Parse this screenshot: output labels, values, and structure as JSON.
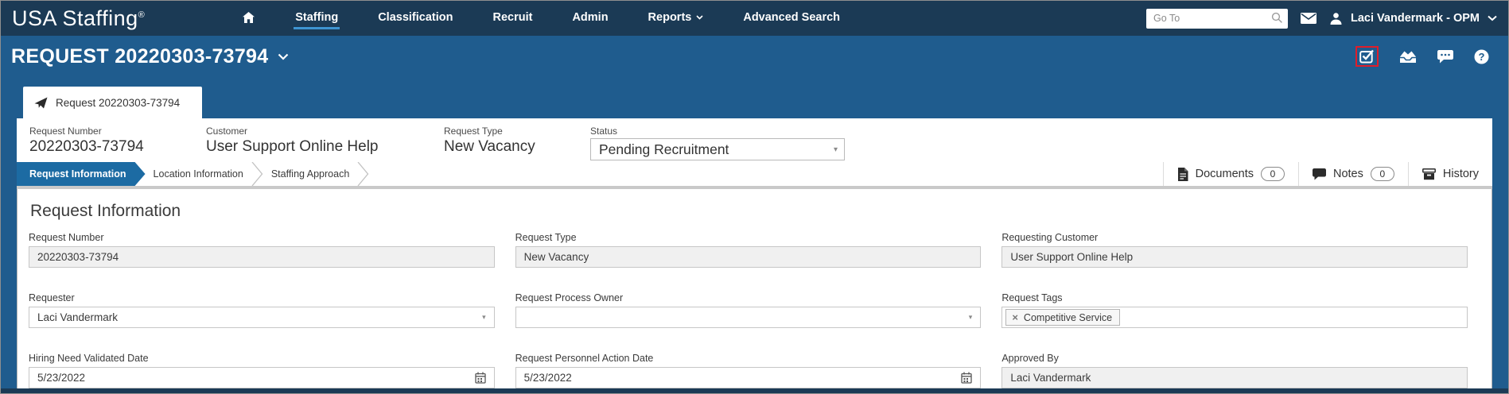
{
  "navbar": {
    "brand": "USA Staffing",
    "reg": "®",
    "items": [
      {
        "label": "Staffing",
        "active": true
      },
      {
        "label": "Classification"
      },
      {
        "label": "Recruit"
      },
      {
        "label": "Admin"
      },
      {
        "label": "Reports"
      },
      {
        "label": "Advanced Search"
      }
    ],
    "goto_placeholder": "Go To",
    "user_name": "Laci Vandermark - OPM"
  },
  "title_bar": {
    "title": "REQUEST 20220303-73794"
  },
  "tab": {
    "label": "Request 20220303-73794"
  },
  "summary": {
    "fields": [
      {
        "label": "Request Number",
        "value": "20220303-73794"
      },
      {
        "label": "Customer",
        "value": "User Support Online Help"
      },
      {
        "label": "Request Type",
        "value": "New Vacancy"
      }
    ],
    "status": {
      "label": "Status",
      "value": "Pending Recruitment"
    }
  },
  "subtabs": [
    {
      "label": "Request Information",
      "active": true
    },
    {
      "label": "Location Information"
    },
    {
      "label": "Staffing Approach"
    }
  ],
  "actions": {
    "documents": {
      "label": "Documents",
      "count": "0"
    },
    "notes": {
      "label": "Notes",
      "count": "0"
    },
    "history": {
      "label": "History"
    }
  },
  "form": {
    "heading": "Request Information",
    "fields": [
      {
        "label": "Request Number",
        "value": "20220303-73794",
        "type": "readonly"
      },
      {
        "label": "Request Type",
        "value": "New Vacancy",
        "type": "readonly"
      },
      {
        "label": "Requesting Customer",
        "value": "User Support Online Help",
        "type": "readonly"
      },
      {
        "label": "Requester",
        "value": "Laci Vandermark",
        "type": "select"
      },
      {
        "label": "Request Process Owner",
        "value": "",
        "type": "select"
      },
      {
        "label": "Request Tags",
        "value": "Competitive Service",
        "type": "tags"
      },
      {
        "label": "Hiring Need Validated Date",
        "value": "5/23/2022",
        "type": "date"
      },
      {
        "label": "Request Personnel Action Date",
        "value": "5/23/2022",
        "type": "date"
      },
      {
        "label": "Approved By",
        "value": "Laci Vandermark",
        "type": "readonly"
      }
    ]
  },
  "icons": {
    "select_caret": "▾",
    "tag_remove": "×"
  },
  "colors": {
    "navbar_bg": "#1b3a55",
    "titlebar_bg": "#1f5c8e",
    "nav_active_underline": "#3e94d1",
    "subtab_active_bg": "#1c6ba3",
    "highlight_red": "#e01d2a",
    "readonly_bg": "#f0f0f0",
    "divider": "#c9c9c9"
  }
}
